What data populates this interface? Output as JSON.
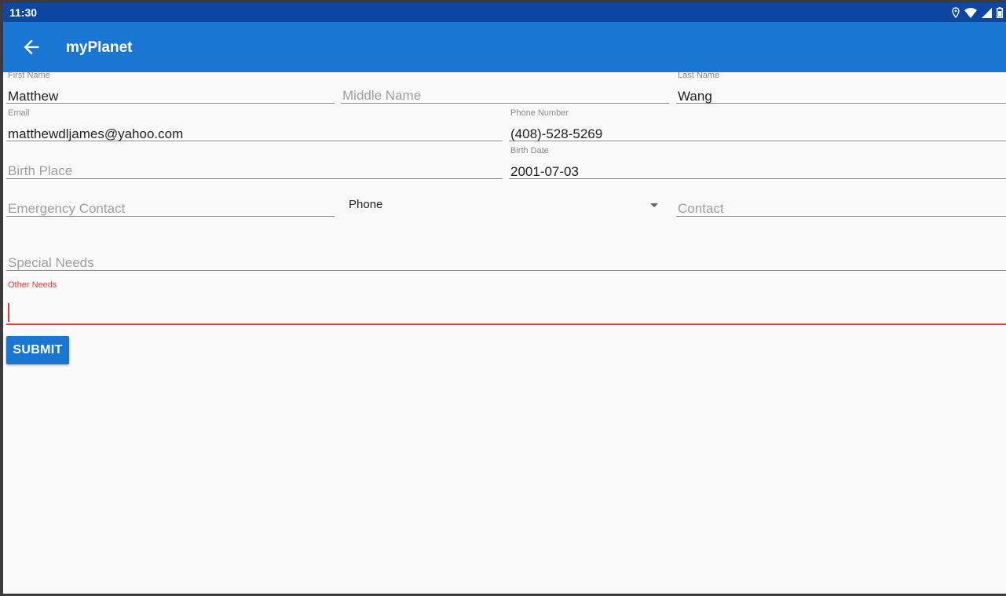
{
  "status": {
    "time": "11:30"
  },
  "appbar": {
    "title": "myPlanet"
  },
  "form": {
    "first_name": {
      "label": "First Name",
      "value": "Matthew"
    },
    "middle_name": {
      "hint": "Middle Name"
    },
    "last_name": {
      "label": "Last Name",
      "value": "Wang"
    },
    "email": {
      "label": "Email",
      "value": "matthewdljames@yahoo.com"
    },
    "phone_number": {
      "label": "Phone Number",
      "value": "(408)-528-5269"
    },
    "birth_place": {
      "hint": "Birth Place"
    },
    "birth_date": {
      "label": "Birth Date",
      "value": "2001-07-03"
    },
    "emergency_contact": {
      "hint": "Emergency Contact"
    },
    "contact_type": {
      "value": "Phone"
    },
    "contact": {
      "hint": "Contact"
    },
    "special_needs": {
      "hint": "Special Needs"
    },
    "other_needs": {
      "label": "Other Needs",
      "value": ""
    }
  },
  "submit_label": "SUBMIT",
  "colors": {
    "status_bar": "#0d47a1",
    "app_bar": "#1976d2",
    "error_accent": "#e53935"
  }
}
